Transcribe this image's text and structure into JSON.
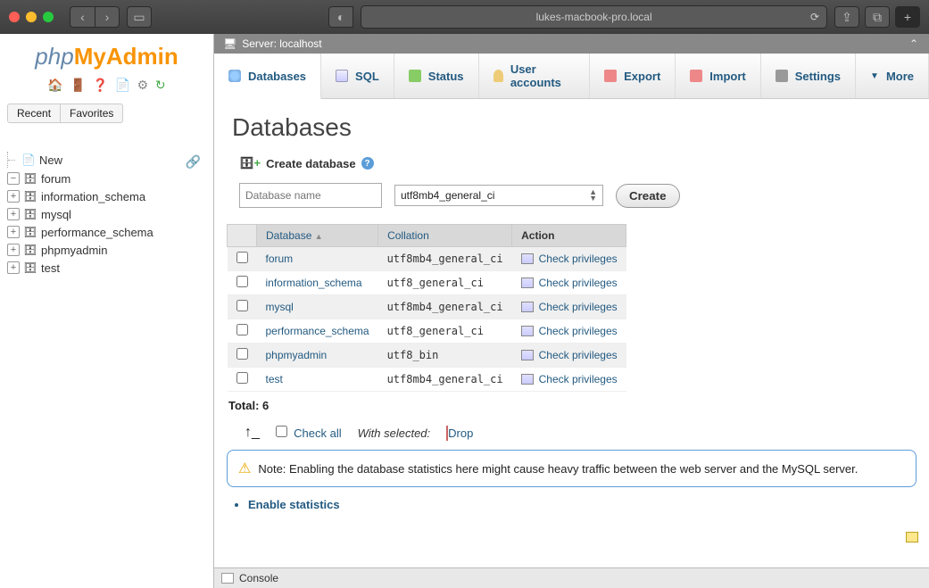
{
  "browser": {
    "url": "lukes-macbook-pro.local"
  },
  "logo": {
    "php": "php",
    "my": "My",
    "admin": "Admin"
  },
  "sidebar": {
    "tabs": {
      "recent": "Recent",
      "favorites": "Favorites"
    },
    "tree": [
      {
        "label": "New",
        "toggle": ""
      },
      {
        "label": "forum",
        "toggle": "−"
      },
      {
        "label": "information_schema",
        "toggle": "+"
      },
      {
        "label": "mysql",
        "toggle": "+"
      },
      {
        "label": "performance_schema",
        "toggle": "+"
      },
      {
        "label": "phpmyadmin",
        "toggle": "+"
      },
      {
        "label": "test",
        "toggle": "+"
      }
    ]
  },
  "server_bar": {
    "label": "Server: localhost"
  },
  "tabs": {
    "databases": "Databases",
    "sql": "SQL",
    "status": "Status",
    "users": "User accounts",
    "export": "Export",
    "import": "Import",
    "settings": "Settings",
    "more": "More"
  },
  "page_title": "Databases",
  "create": {
    "label": "Create database",
    "placeholder": "Database name",
    "collation": "utf8mb4_general_ci",
    "button": "Create"
  },
  "table": {
    "headers": {
      "database": "Database",
      "collation": "Collation",
      "action": "Action"
    },
    "check_label": "Check privileges",
    "rows": [
      {
        "name": "forum",
        "collation": "utf8mb4_general_ci"
      },
      {
        "name": "information_schema",
        "collation": "utf8_general_ci"
      },
      {
        "name": "mysql",
        "collation": "utf8mb4_general_ci"
      },
      {
        "name": "performance_schema",
        "collation": "utf8_general_ci"
      },
      {
        "name": "phpmyadmin",
        "collation": "utf8_bin"
      },
      {
        "name": "test",
        "collation": "utf8mb4_general_ci"
      }
    ]
  },
  "total": "Total: 6",
  "bulk": {
    "check_all": "Check all",
    "with_selected": "With selected:",
    "drop": "Drop"
  },
  "note": "Note: Enabling the database statistics here might cause heavy traffic between the web server and the MySQL server.",
  "enable_stats": "Enable statistics",
  "console": "Console"
}
